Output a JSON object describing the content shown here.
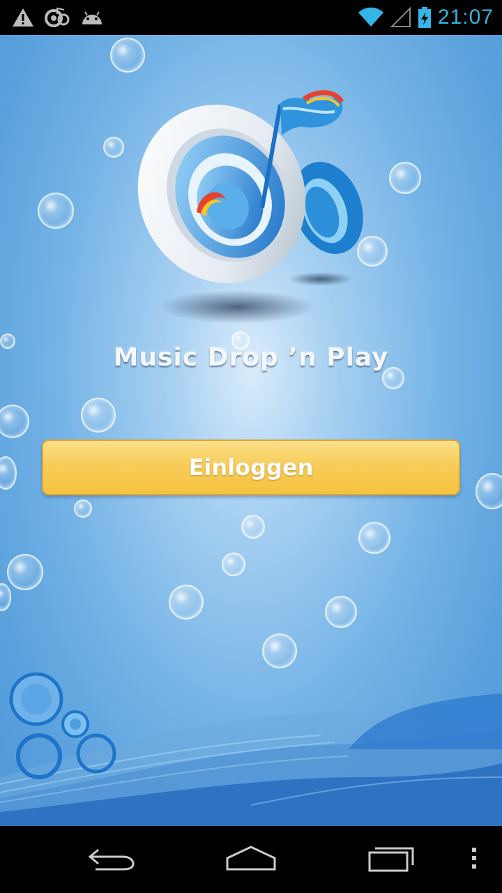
{
  "status_bar": {
    "time": "21:07",
    "left_icons": [
      "warning-icon",
      "app-notification-icon",
      "android-icon"
    ],
    "right_icons": [
      "wifi-icon",
      "cell-signal-icon",
      "battery-charging-icon"
    ],
    "accent_color": "#33b5e5"
  },
  "app": {
    "brand_name": "Music Drop ’n Play",
    "login_button_label": "Einloggen",
    "colors": {
      "background": "#74b3e6",
      "button": "#f7c84e",
      "button_text": "#ffffff"
    }
  },
  "nav_bar": {
    "icons": [
      "back-icon",
      "home-icon",
      "recent-apps-icon",
      "overflow-menu-icon"
    ]
  }
}
